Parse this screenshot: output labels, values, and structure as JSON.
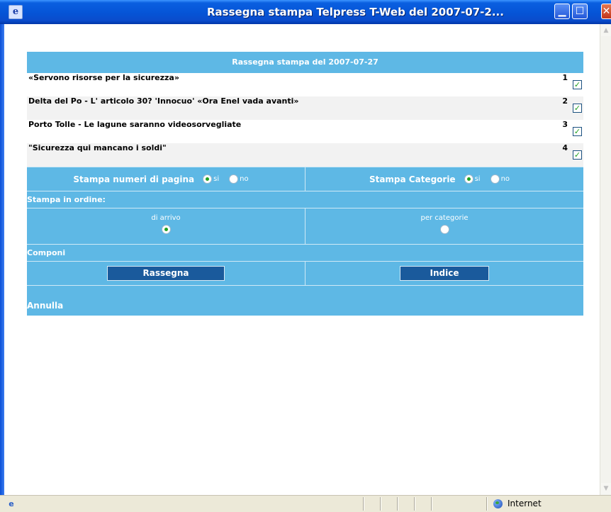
{
  "window": {
    "title": "Rassegna stampa Telpress T-Web del 2007-07-2...",
    "app_icon": "ie-page-icon",
    "controls": [
      "minimize-icon",
      "maximize-icon",
      "close-icon"
    ]
  },
  "header": {
    "title": "Rassegna stampa del 2007-07-27"
  },
  "articles": [
    {
      "title": "«Servono risorse per la sicurezza»",
      "number": "1",
      "checked": true
    },
    {
      "title": "Delta del Po - L' articolo 30? 'Innocuo' «Ora Enel vada avanti»",
      "number": "2",
      "checked": true
    },
    {
      "title": "Porto Tolle - Le lagune saranno videosorvegliate",
      "number": "3",
      "checked": true
    },
    {
      "title": "\"Sicurezza qui mancano i soldi\"",
      "number": "4",
      "checked": true
    }
  ],
  "options": {
    "page_numbers": {
      "label": "Stampa numeri di pagina",
      "yes": "si",
      "no": "no",
      "selected": "si"
    },
    "categories": {
      "label": "Stampa Categorie",
      "yes": "si",
      "no": "no",
      "selected": "si"
    },
    "order_title": "Stampa in ordine:",
    "order": {
      "arrival": "di arrivo",
      "by_category": "per categorie",
      "selected": "di arrivo"
    },
    "compose_title": "Componi",
    "buttons": {
      "rassegna": "Rassegna",
      "indice": "Indice"
    },
    "cancel": "Annulla"
  },
  "statusbar": {
    "zone": "Internet"
  },
  "colors": {
    "panel": "#5eb8e5",
    "button": "#1a5a9c",
    "check": "#21a121",
    "titlebar": "#0554d6"
  }
}
